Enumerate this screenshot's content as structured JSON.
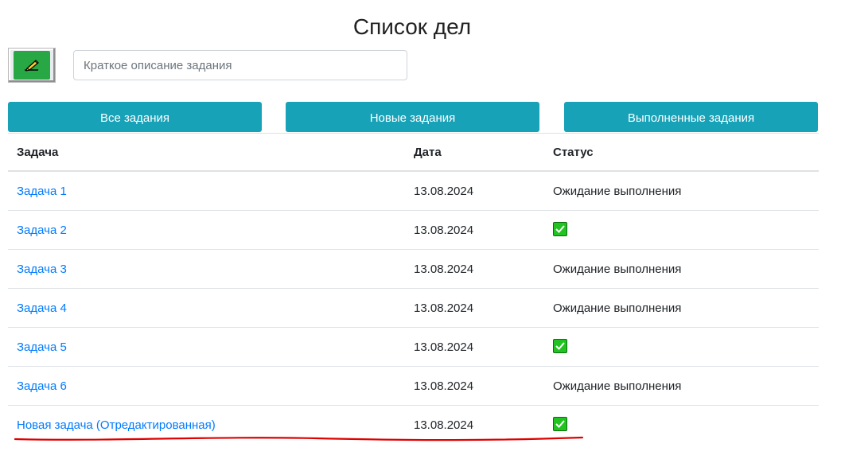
{
  "page_title": "Список дел",
  "add_button": {
    "icon": "pencil-writing-icon"
  },
  "task_input": {
    "placeholder": "Краткое описание задания",
    "value": ""
  },
  "filters": {
    "all_label": "Все задания",
    "new_label": "Новые задания",
    "done_label": "Выполненные задания"
  },
  "table": {
    "headers": {
      "task": "Задача",
      "date": "Дата",
      "status": "Статус"
    },
    "rows": [
      {
        "task": "Задача 1",
        "date": "13.08.2024",
        "status": "Ожидание выполнения",
        "done": false
      },
      {
        "task": "Задача 2",
        "date": "13.08.2024",
        "status": "",
        "done": true
      },
      {
        "task": "Задача 3",
        "date": "13.08.2024",
        "status": "Ожидание выполнения",
        "done": false
      },
      {
        "task": "Задача 4",
        "date": "13.08.2024",
        "status": "Ожидание выполнения",
        "done": false
      },
      {
        "task": "Задача 5",
        "date": "13.08.2024",
        "status": "",
        "done": true
      },
      {
        "task": "Задача 6",
        "date": "13.08.2024",
        "status": "Ожидание выполнения",
        "done": false
      },
      {
        "task": "Новая задача (Отредактированная)",
        "date": "13.08.2024",
        "status": "",
        "done": true
      }
    ]
  },
  "colors": {
    "accent": "#17a2b8",
    "link": "#007bff",
    "add_button": "#28a745",
    "done_check": "#21c321",
    "annotation": "#e00000"
  }
}
